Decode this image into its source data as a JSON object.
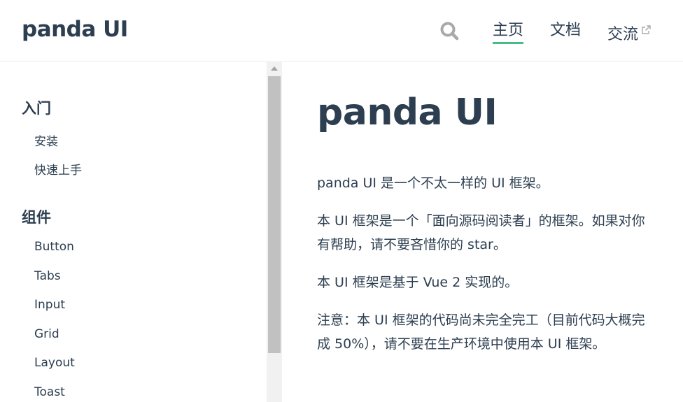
{
  "header": {
    "site_name": "panda UI",
    "nav": [
      {
        "label": "主页"
      },
      {
        "label": "文档"
      },
      {
        "label": "交流"
      }
    ],
    "icons": {
      "search": "search-icon",
      "external": "external-link-icon"
    },
    "accent_color": "#46bd87"
  },
  "sidebar": {
    "groups": [
      {
        "title": "入门",
        "items": [
          "安装",
          "快速上手"
        ]
      },
      {
        "title": "组件",
        "items": [
          "Button",
          "Tabs",
          "Input",
          "Grid",
          "Layout",
          "Toast"
        ]
      }
    ]
  },
  "main": {
    "title": "panda UI",
    "paragraphs": [
      "panda UI 是一个不太一样的 UI 框架。",
      "本 UI 框架是一个「面向源码阅读者」的框架。如果对你有帮助，请不要吝惜你的 star。",
      "本 UI 框架是基于 Vue 2 实现的。",
      "注意：本 UI 框架的代码尚未完全完工（目前代码大概完成 50%），请不要在生产环境中使用本 UI 框架。"
    ]
  }
}
